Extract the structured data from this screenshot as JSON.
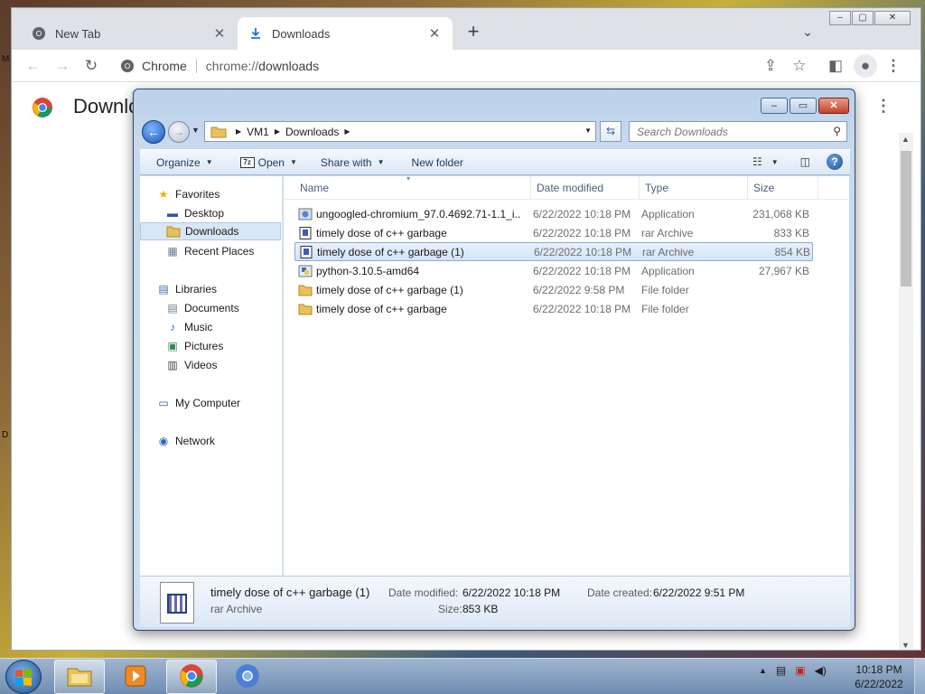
{
  "desktop": {
    "edge_letters": [
      "M",
      "D"
    ]
  },
  "chrome": {
    "tabs": [
      {
        "title": "New Tab",
        "active": false
      },
      {
        "title": "Downloads",
        "active": true
      }
    ],
    "omnibox": {
      "site_label": "Chrome",
      "url_scheme": "chrome://",
      "url_rest": "downloads"
    },
    "page": {
      "title": "Downloads"
    }
  },
  "explorer": {
    "breadcrumb": [
      "VM1",
      "Downloads"
    ],
    "search_placeholder": "Search Downloads",
    "commands": {
      "organize": "Organize",
      "open": "Open",
      "share_with": "Share with",
      "new_folder": "New folder"
    },
    "nav": {
      "favorites": "Favorites",
      "desktop": "Desktop",
      "downloads": "Downloads",
      "recent_places": "Recent Places",
      "libraries": "Libraries",
      "documents": "Documents",
      "music": "Music",
      "pictures": "Pictures",
      "videos": "Videos",
      "my_computer": "My Computer",
      "network": "Network"
    },
    "columns": {
      "name": "Name",
      "date": "Date modified",
      "type": "Type",
      "size": "Size"
    },
    "files": [
      {
        "name": "ungoogled-chromium_97.0.4692.71-1.1_i...",
        "date": "6/22/2022 10:18 PM",
        "type": "Application",
        "size": "231,068 KB",
        "icon": "installer-icon"
      },
      {
        "name": "timely dose of c++ garbage",
        "date": "6/22/2022 10:18 PM",
        "type": "rar Archive",
        "size": "833 KB",
        "icon": "rar-archive-icon"
      },
      {
        "name": "timely dose of c++ garbage (1)",
        "date": "6/22/2022 10:18 PM",
        "type": "rar Archive",
        "size": "854 KB",
        "icon": "rar-archive-icon",
        "selected": true
      },
      {
        "name": "python-3.10.5-amd64",
        "date": "6/22/2022 10:18 PM",
        "type": "Application",
        "size": "27,967 KB",
        "icon": "python-installer-icon"
      },
      {
        "name": "timely dose of c++ garbage (1)",
        "date": "6/22/2022 9:58 PM",
        "type": "File folder",
        "size": "",
        "icon": "folder-icon"
      },
      {
        "name": "timely dose of c++ garbage",
        "date": "6/22/2022 10:18 PM",
        "type": "File folder",
        "size": "",
        "icon": "folder-icon"
      }
    ],
    "details": {
      "name": "timely dose of c++ garbage (1)",
      "type": "rar Archive",
      "date_modified_label": "Date modified:",
      "date_modified": "6/22/2022 10:18 PM",
      "date_created_label": "Date created:",
      "date_created": "6/22/2022 9:51 PM",
      "size_label": "Size:",
      "size": "853 KB"
    }
  },
  "taskbar": {
    "pinned": [
      "explorer-icon",
      "media-player-icon",
      "chrome-icon",
      "chromium-icon"
    ],
    "clock": {
      "time": "10:18 PM",
      "date": "6/22/2022"
    }
  },
  "colors": {
    "selection": "#d2e4f8",
    "taskbar": "#7f9ab8",
    "chrome_tabstrip": "#dee1e6"
  }
}
